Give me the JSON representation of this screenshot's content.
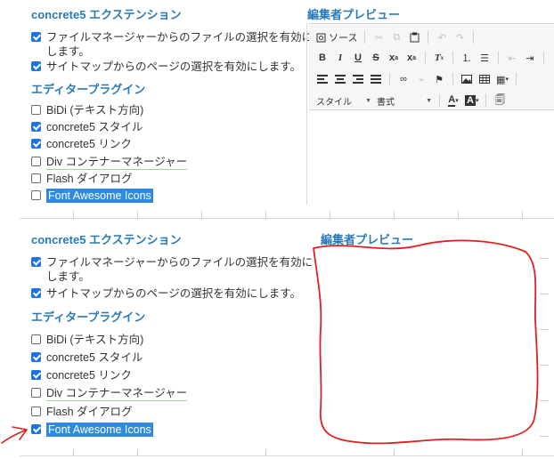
{
  "top": {
    "ext_heading": "concrete5 エクステンション",
    "ext_options": [
      {
        "label_line1": "ファイルマネージャーからのファイルの選択を有効に",
        "label_line2": "します。",
        "checked": true
      },
      {
        "label_line1": "サイトマップからのページの選択を有効にします。",
        "label_line2": "",
        "checked": true
      }
    ],
    "plugins_heading": "エディタープラグイン",
    "plugins": [
      {
        "label": "BiDi (テキスト方向)",
        "checked": false
      },
      {
        "label": "concrete5 スタイル",
        "checked": true
      },
      {
        "label": "concrete5 リンク",
        "checked": true
      },
      {
        "label": "Div コンテナーマネージャー",
        "checked": false
      },
      {
        "label": "Flash ダイアログ",
        "checked": false
      },
      {
        "label": "Font Awesome Icons",
        "checked": false
      }
    ],
    "preview_heading": "編集者プレビュー"
  },
  "editor": {
    "source_label": "ソース",
    "style_combo": "スタイル",
    "format_combo": "書式"
  },
  "bottom": {
    "ext_heading": "concrete5 エクステンション",
    "ext_options": [
      {
        "label_line1": "ファイルマネージャーからのファイルの選択を有効に",
        "label_line2": "します。",
        "checked": true
      },
      {
        "label_line1": "サイトマップからのページの選択を有効にします。",
        "label_line2": "",
        "checked": true
      }
    ],
    "plugins_heading": "エディタープラグイン",
    "plugins": [
      {
        "label": "BiDi (テキスト方向)",
        "checked": false
      },
      {
        "label": "concrete5 スタイル",
        "checked": true
      },
      {
        "label": "concrete5 リンク",
        "checked": true
      },
      {
        "label": "Div コンテナーマネージャー",
        "checked": false
      },
      {
        "label": "Flash ダイアログ",
        "checked": false
      },
      {
        "label": "Font Awesome Icons",
        "checked": true
      }
    ],
    "preview_heading": "編集者プレビュー"
  },
  "colors": {
    "heading": "#2a7ab8",
    "checkbox_on": "#1a73e8",
    "selection": "#2f8ae2",
    "annotation": "#e02020"
  }
}
